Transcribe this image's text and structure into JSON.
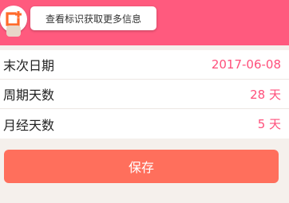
{
  "theme": {
    "header_color": "#ff5a7e",
    "value_color": "#ff4f7b",
    "button_color": "#ff6f5c",
    "logo_color": "#ff6a2b"
  },
  "header": {
    "logo_icon": "app-logo-icon",
    "tooltip_text": "查看标识获取更多信息"
  },
  "settings": [
    {
      "label": "末次日期",
      "value": "2017-06-08"
    },
    {
      "label": "周期天数",
      "value": "28 天"
    },
    {
      "label": "月经天数",
      "value": "5 天"
    }
  ],
  "actions": {
    "save_label": "保存"
  }
}
